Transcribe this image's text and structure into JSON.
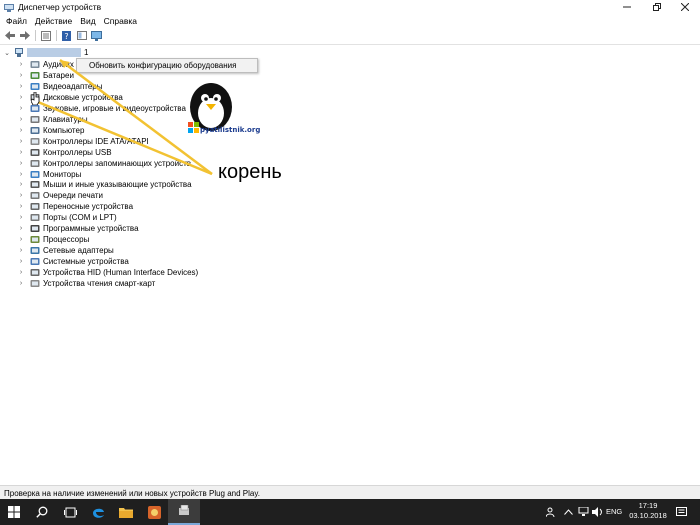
{
  "window": {
    "title": "Диспетчер устройств"
  },
  "menubar": {
    "items": [
      "Файл",
      "Действие",
      "Вид",
      "Справка"
    ]
  },
  "toolbar": {
    "icons": [
      "back-arrow-icon",
      "forward-arrow-icon",
      "properties-icon",
      "help-icon",
      "view-icon",
      "monitor-scan-icon"
    ]
  },
  "tree": {
    "root_suffix": "1",
    "items": [
      "Аудиовх",
      "Батареи",
      "Видеоадаптеры",
      "Дисковые устройства",
      "Звуковые, игровые и видеоустройства",
      "Клавиатуры",
      "Компьютер",
      "Контроллеры IDE ATA/ATAPI",
      "Контроллеры USB",
      "Контроллеры запоминающих устройств",
      "Мониторы",
      "Мыши и иные указывающие устройства",
      "Очереди печати",
      "Переносные устройства",
      "Порты (COM и LPT)",
      "Программные устройства",
      "Процессоры",
      "Сетевые адаптеры",
      "Системные устройства",
      "Устройства HID (Human Interface Devices)",
      "Устройства чтения смарт-карт"
    ]
  },
  "context_menu": {
    "item": "Обновить конфигурацию оборудования"
  },
  "annotation": {
    "label": "корень",
    "logo_text": "pyatilistnik.org"
  },
  "statusbar": {
    "text": "Проверка на наличие изменений или новых устройств Plug and Play."
  },
  "taskbar": {
    "lang": "ENG",
    "time": "17:19",
    "date": "03.10.2018"
  },
  "colors": {
    "annotation_arrow": "#f2c232",
    "taskbar": "#1f1f1f",
    "selection": "#b9cde5"
  }
}
